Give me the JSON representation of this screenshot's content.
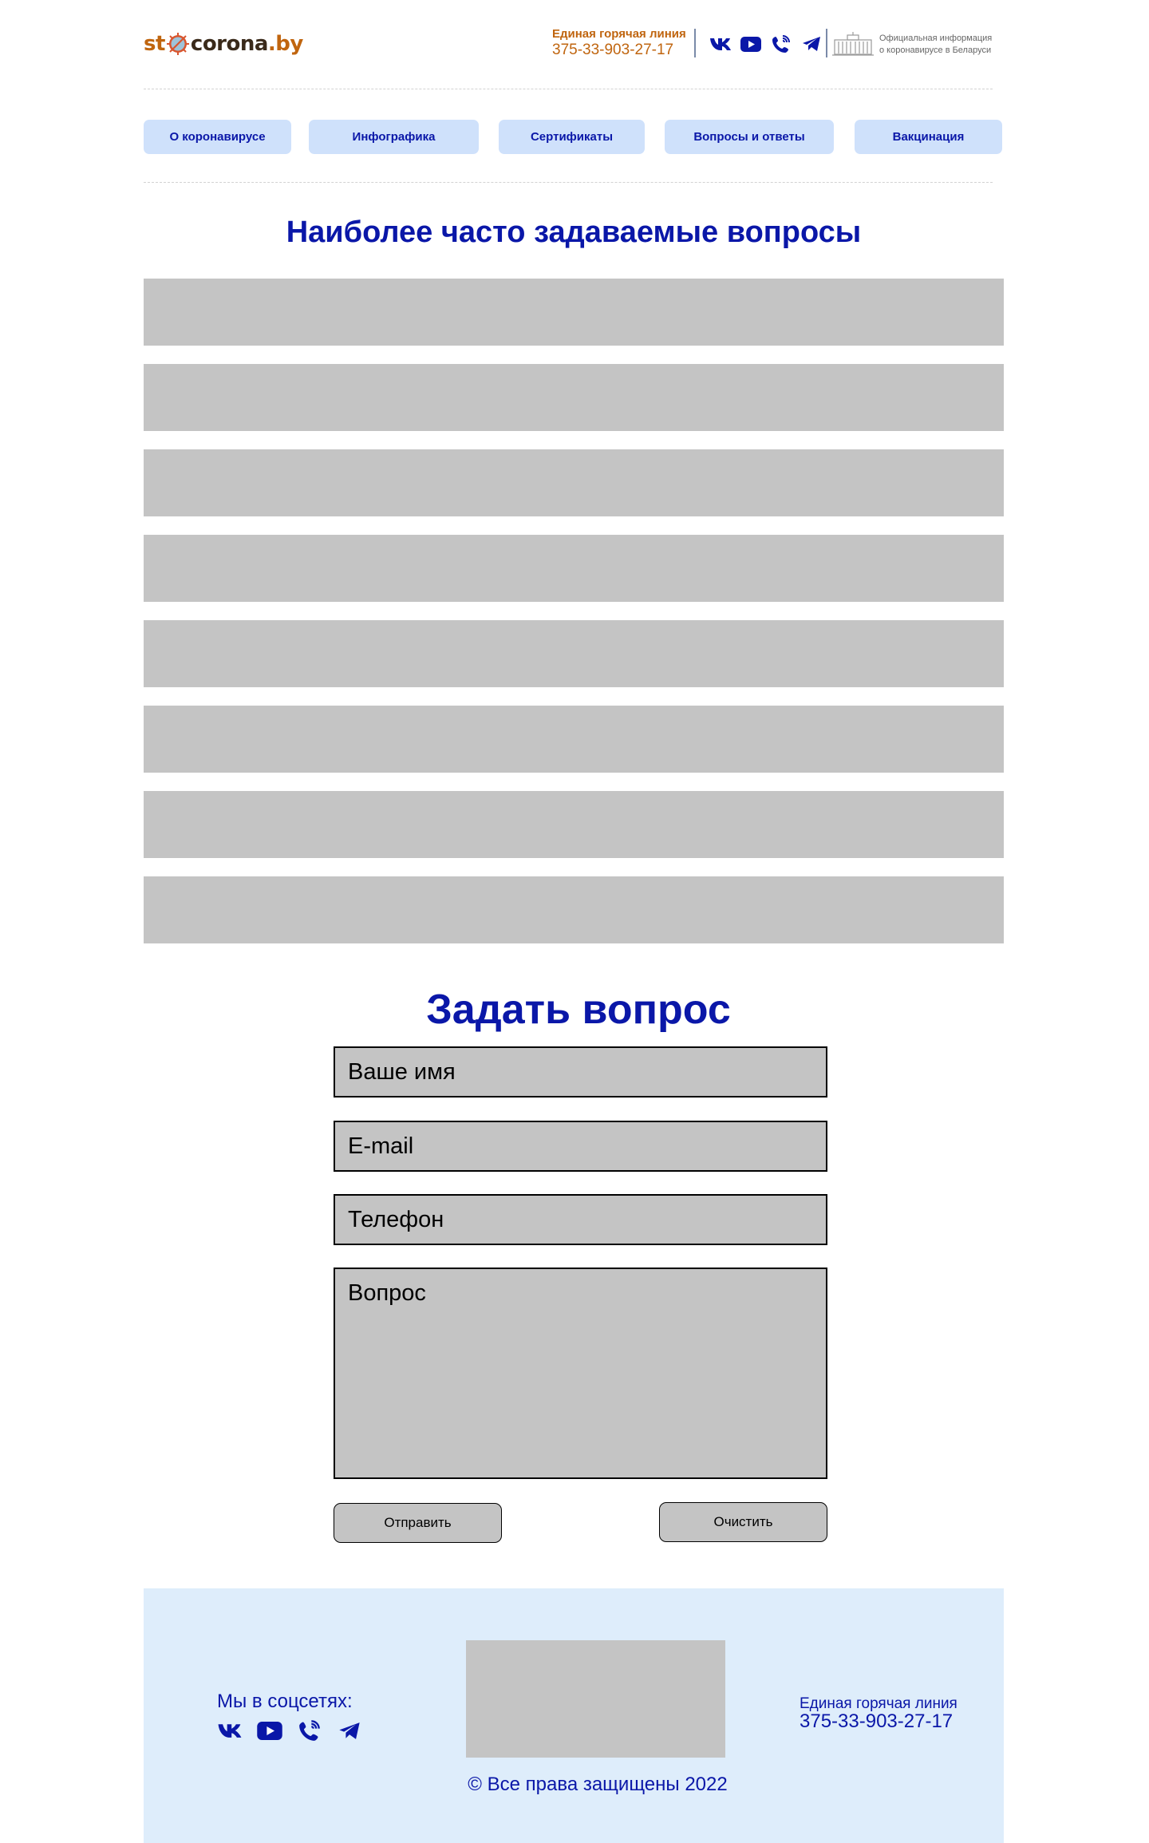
{
  "header": {
    "logo": {
      "part1": "st",
      "part2": "corona",
      "part3": ".by"
    },
    "hotline": {
      "label": "Единая горячая линия",
      "phone": "375-33-903-27-17"
    },
    "socials": [
      {
        "icon": "vk-icon"
      },
      {
        "icon": "youtube-icon"
      },
      {
        "icon": "viber-icon"
      },
      {
        "icon": "telegram-icon"
      }
    ],
    "official": {
      "line1": "Официальная информация",
      "line2": "о коронавирусе в Беларуси"
    }
  },
  "nav": [
    {
      "label": "О коронавирусе"
    },
    {
      "label": "Инфографика"
    },
    {
      "label": "Сертификаты"
    },
    {
      "label": "Вопросы и ответы"
    },
    {
      "label": "Вакцинация"
    }
  ],
  "faq": {
    "title": "Наиболее часто задаваемые вопросы",
    "item_count": 8
  },
  "ask": {
    "title": "Задать вопрос",
    "name_placeholder": "Ваше имя",
    "email_placeholder": "E-mail",
    "phone_placeholder": "Телефон",
    "question_placeholder": "Вопрос",
    "submit_label": "Отправить",
    "clear_label": "Очистить"
  },
  "footer": {
    "social_label": "Мы в соцсетях:",
    "copyright": "© Все права защищены 2022",
    "hotline": {
      "label": "Единая горячая линия",
      "phone": "375-33-903-27-17"
    }
  },
  "colors": {
    "accent_blue": "#0a17a8",
    "accent_orange": "#c0650f",
    "nav_bg": "#cfe1fb",
    "footer_bg": "#deedfb",
    "placeholder_gray": "#c4c4c4"
  }
}
